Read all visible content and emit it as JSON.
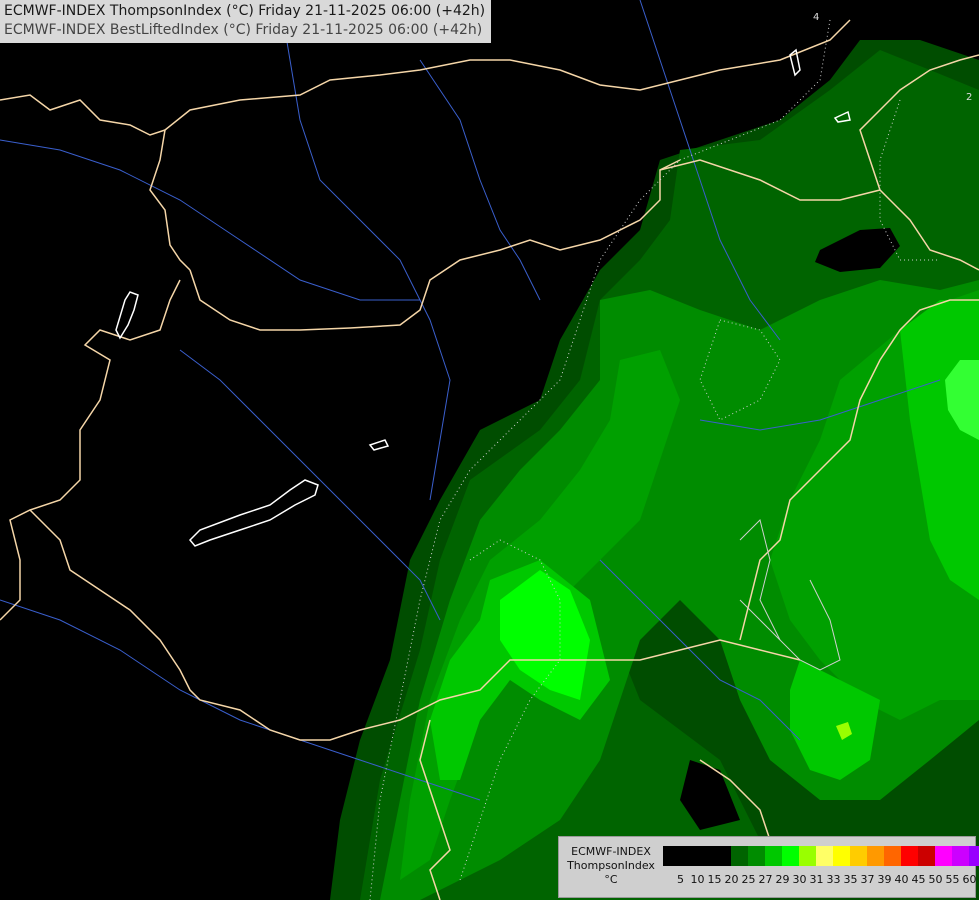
{
  "title": {
    "line1": "ECMWF-INDEX ThompsonIndex (°C) Friday 21-11-2025 06:00 (+42h)",
    "line2": "ECMWF-INDEX BestLiftedIndex (°C) Friday 21-11-2025 06:00 (+42h)"
  },
  "legend": {
    "source": "ECMWF-INDEX",
    "parameter": "ThompsonIndex",
    "unit": "°C",
    "ticks": [
      "5",
      "10",
      "15",
      "20",
      "25",
      "27",
      "29",
      "30",
      "31",
      "33",
      "35",
      "37",
      "39",
      "40",
      "45",
      "50",
      "55",
      "60"
    ],
    "colors": [
      "#000000",
      "#000000",
      "#000000",
      "#000000",
      "#006400",
      "#008c00",
      "#00c800",
      "#00ff00",
      "#99ff00",
      "#ffff66",
      "#ffff00",
      "#ffcc00",
      "#ff9900",
      "#ff6600",
      "#ff0000",
      "#cc0000",
      "#ff00ff",
      "#cc00ff",
      "#9900ff",
      "#6600ff",
      "#0000ff"
    ]
  },
  "contour_labels": [
    "4",
    "2"
  ],
  "colors": {
    "background": "#000000",
    "border": "#f5d6a8",
    "river": "#3a5fcd",
    "lake": "#ffffff",
    "contour": "#d0d0d0"
  }
}
